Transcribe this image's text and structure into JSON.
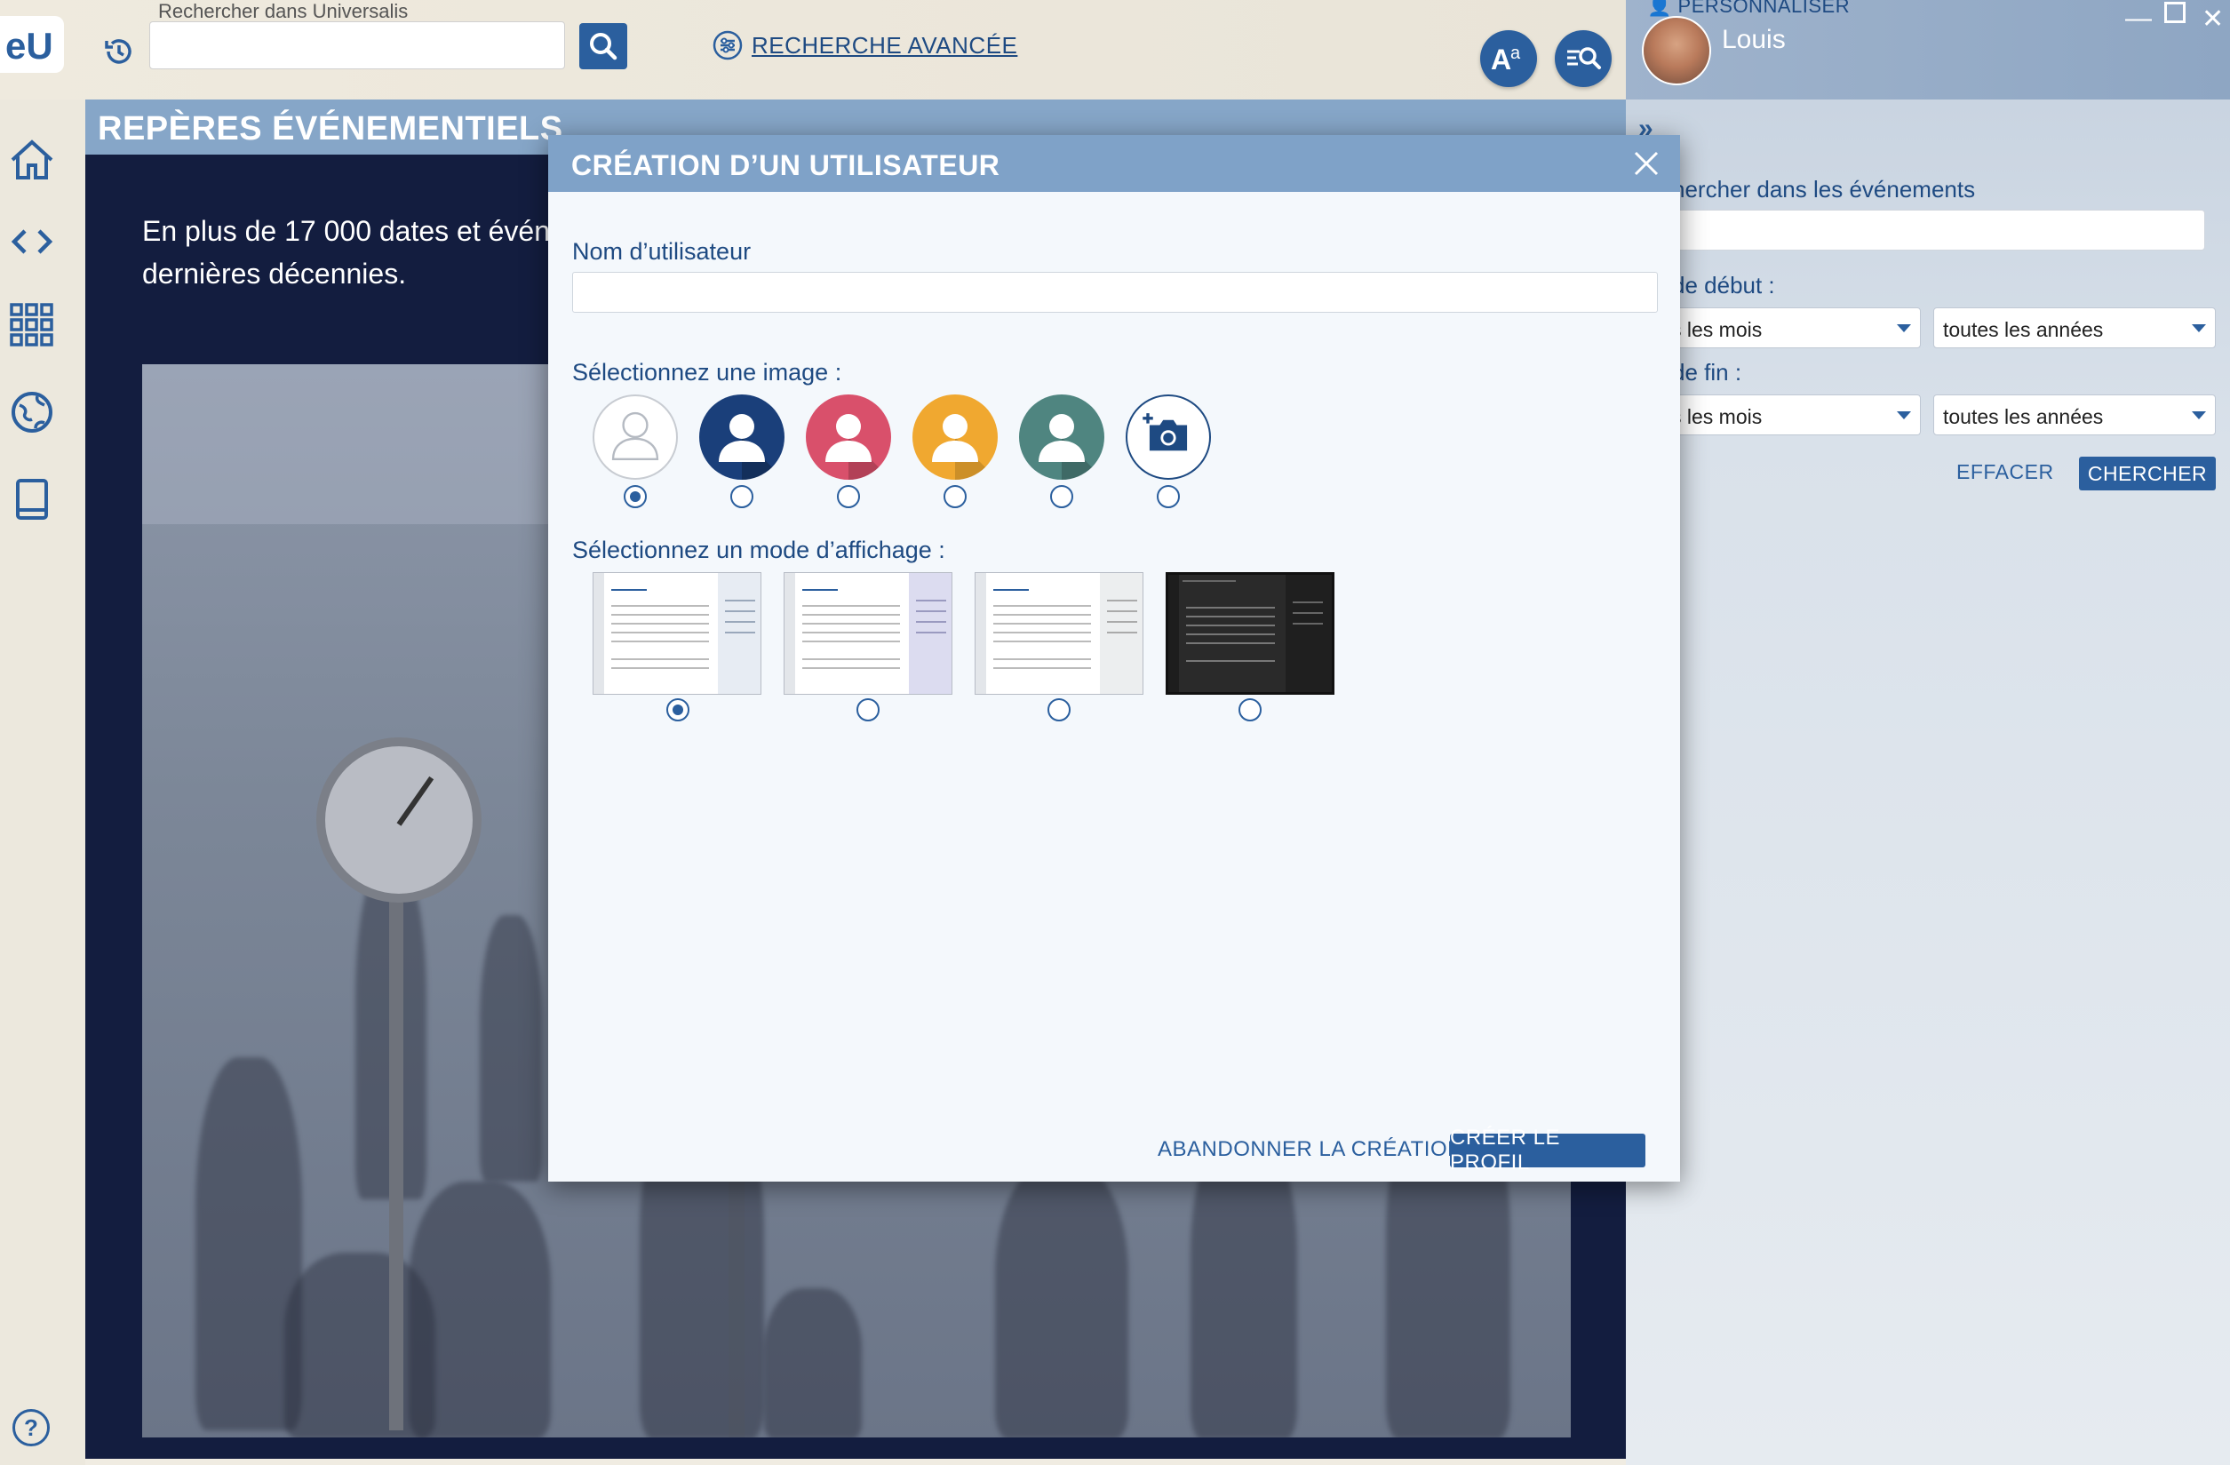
{
  "topbar": {
    "search_label": "Rechercher dans Universalis",
    "search_placeholder": "",
    "advanced_search_label": "RECHERCHE AVANCÉE"
  },
  "article": {
    "title": "REPÈRES ÉVÉNEMENTIELS",
    "intro": "En plus de 17 000 dates et événe dernières décennies."
  },
  "right_panel": {
    "personalize_label": "PERSONNALISER",
    "user_name": "Louis",
    "search_events_label": "hercher dans les événements",
    "start_label": "de début :",
    "end_label": "de fin :",
    "start_month": "s les mois",
    "start_year": "toutes les années",
    "end_month": "s les mois",
    "end_year": "toutes les années",
    "clear_label": "EFFACER",
    "search_label": "CHERCHER"
  },
  "modal": {
    "title": "CRÉATION D’UN UTILISATEUR",
    "username_label": "Nom d’utilisateur",
    "username_value": "",
    "image_label": "Sélectionnez une image :",
    "display_mode_label": "Sélectionnez un mode d’affichage :",
    "avatars": [
      {
        "icon": "person-outline-icon",
        "color": "#ffffff",
        "selected": true
      },
      {
        "icon": "person-icon",
        "color": "#1a3f7a",
        "selected": false
      },
      {
        "icon": "person-icon",
        "color": "#d9506b",
        "selected": false
      },
      {
        "icon": "person-icon",
        "color": "#f0a830",
        "selected": false
      },
      {
        "icon": "person-icon",
        "color": "#4f8580",
        "selected": false
      },
      {
        "icon": "add-photo-icon",
        "color": "#ffffff",
        "selected": false
      }
    ],
    "display_modes": [
      {
        "theme": "light-blue-sidebar",
        "selected": true
      },
      {
        "theme": "light-purple-sidebar",
        "selected": false
      },
      {
        "theme": "light-grey-sidebar",
        "selected": false
      },
      {
        "theme": "dark",
        "selected": false
      }
    ],
    "cancel_label": "ABANDONNER LA CRÉATION",
    "create_label": "CRÉER LE PROFIL"
  },
  "colors": {
    "accent": "#2b5f9e",
    "header_blue": "#7fa2c8",
    "article_bg": "#131d3f"
  }
}
